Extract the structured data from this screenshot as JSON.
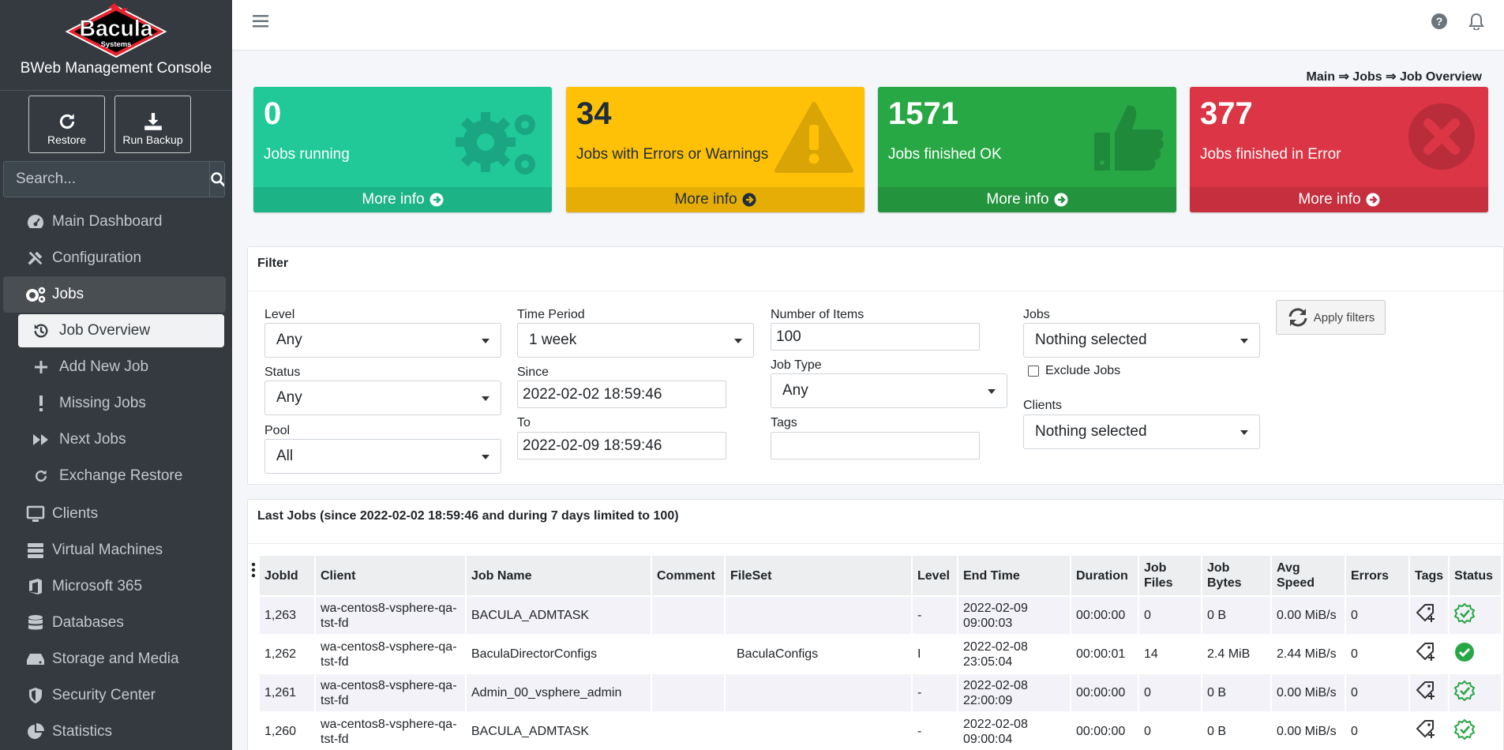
{
  "sidebar": {
    "logo_text": "Bacula",
    "logo_sub": "Systems",
    "brand": "BWeb Management Console",
    "restore": "Restore",
    "run_backup": "Run Backup",
    "search_placeholder": "Search...",
    "items": [
      {
        "label": "Main Dashboard",
        "icon": "dashboard-icon"
      },
      {
        "label": "Configuration",
        "icon": "tools-icon"
      },
      {
        "label": "Jobs",
        "icon": "cogs-icon"
      },
      {
        "label": "Clients",
        "icon": "monitor-icon"
      },
      {
        "label": "Virtual Machines",
        "icon": "server-icon"
      },
      {
        "label": "Microsoft 365",
        "icon": "office-icon"
      },
      {
        "label": "Databases",
        "icon": "database-icon"
      },
      {
        "label": "Storage and Media",
        "icon": "hdd-icon"
      },
      {
        "label": "Security Center",
        "icon": "shield-icon"
      },
      {
        "label": "Statistics",
        "icon": "pie-chart-icon"
      }
    ],
    "job_sub": [
      {
        "label": "Job Overview",
        "icon": "history-icon"
      },
      {
        "label": "Add New Job",
        "icon": "plus-icon"
      },
      {
        "label": "Missing Jobs",
        "icon": "exclamation-icon"
      },
      {
        "label": "Next Jobs",
        "icon": "forward-icon"
      },
      {
        "label": "Exchange Restore",
        "icon": "redo-icon"
      }
    ]
  },
  "breadcrumb": {
    "main": "Main",
    "jobs": "Jobs",
    "current": "Job Overview",
    "sep": "⇒"
  },
  "kpis": [
    {
      "value": "0",
      "label": "Jobs running",
      "more": "More info",
      "icon": "gears-icon",
      "color": "#20c997"
    },
    {
      "value": "34",
      "label": "Jobs with Errors or Warnings",
      "more": "More info",
      "icon": "warning-icon",
      "color": "#ffc107"
    },
    {
      "value": "1571",
      "label": "Jobs finished OK",
      "more": "More info",
      "icon": "thumbs-up-icon",
      "color": "#28a745"
    },
    {
      "value": "377",
      "label": "Jobs finished in Error",
      "more": "More info",
      "icon": "error-circle-icon",
      "color": "#dc3545"
    }
  ],
  "filter": {
    "title": "Filter",
    "level_label": "Level",
    "level": "Any",
    "status_label": "Status",
    "status": "Any",
    "pool_label": "Pool",
    "pool": "All",
    "period_label": "Time Period",
    "period": "1 week",
    "since_label": "Since",
    "since": "2022-02-02 18:59:46",
    "to_label": "To",
    "to": "2022-02-09 18:59:46",
    "items_label": "Number of Items",
    "items": "100",
    "jobtype_label": "Job Type",
    "jobtype": "Any",
    "tags_label": "Tags",
    "tags": "",
    "jobs_label": "Jobs",
    "jobs": "Nothing selected",
    "exclude_label": "Exclude Jobs",
    "clients_label": "Clients",
    "clients": "Nothing selected",
    "apply": "Apply filters"
  },
  "jobs_table": {
    "title": "Last Jobs (since 2022-02-02 18:59:46 and during 7 days limited to 100)",
    "headers": [
      "JobId",
      "Client",
      "Job Name",
      "Comment",
      "FileSet",
      "Level",
      "End Time",
      "Duration",
      "Job Files",
      "Job Bytes",
      "Avg Speed",
      "Errors",
      "Tags",
      "Status"
    ],
    "rows": [
      [
        "1,263",
        "wa-centos8-vsphere-qa-tst-fd",
        "BACULA_ADMTASK",
        "",
        "",
        "-",
        "2022-02-09 09:00:03",
        "00:00:00",
        "0",
        "0 B",
        "0.00 MiB/s",
        "0"
      ],
      [
        "1,262",
        "wa-centos8-vsphere-qa-tst-fd",
        "BaculaDirectorConfigs",
        "",
        "BaculaConfigs",
        "I",
        "2022-02-08 23:05:04",
        "00:00:01",
        "14",
        "2.4 MiB",
        "2.44 MiB/s",
        "0"
      ],
      [
        "1,261",
        "wa-centos8-vsphere-qa-tst-fd",
        "Admin_00_vsphere_admin",
        "",
        "",
        "-",
        "2022-02-08 22:00:09",
        "00:00:00",
        "0",
        "0 B",
        "0.00 MiB/s",
        "0"
      ],
      [
        "1,260",
        "wa-centos8-vsphere-qa-tst-fd",
        "BACULA_ADMTASK",
        "",
        "",
        "-",
        "2022-02-08 09:00:04",
        "00:00:00",
        "0",
        "0 B",
        "0.00 MiB/s",
        "0"
      ]
    ],
    "row_status": [
      "ok-outline",
      "ok-solid",
      "ok-outline",
      "ok-outline"
    ]
  }
}
